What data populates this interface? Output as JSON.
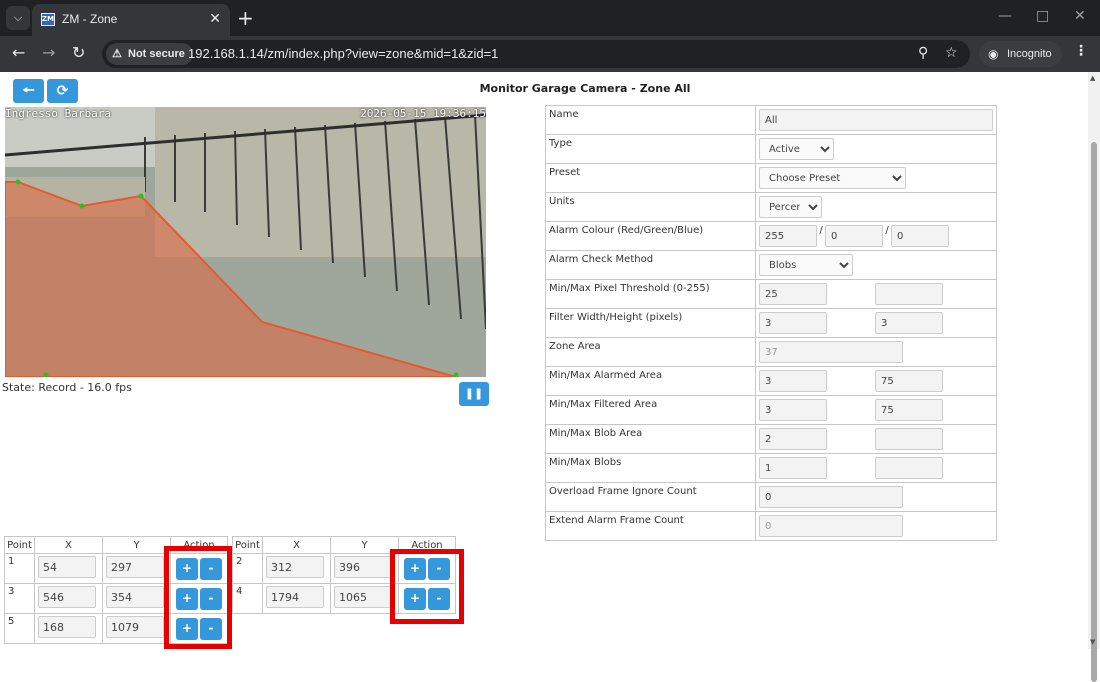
{
  "browser": {
    "tab_title": "ZM - Zone",
    "favicon_text": "ZM",
    "not_secure_label": "Not secure",
    "url": "192.168.1.14/zm/index.php?view=zone&mid=1&zid=1",
    "incognito_label": "Incognito"
  },
  "page": {
    "title": "Monitor Garage Camera - Zone All",
    "camera_name_overlay": "Ingresso Barbara",
    "camera_timestamp_overlay": "2026-05-15 19:36:15",
    "state_text": "State: Record - 16.0 fps"
  },
  "points_table": {
    "headers": {
      "point": "Point",
      "x": "X",
      "y": "Y",
      "action": "Action"
    },
    "plus": "+",
    "minus": "-",
    "left": [
      {
        "point": "1",
        "x": "54",
        "y": "297"
      },
      {
        "point": "3",
        "x": "546",
        "y": "354"
      },
      {
        "point": "5",
        "x": "168",
        "y": "1079"
      }
    ],
    "right": [
      {
        "point": "2",
        "x": "312",
        "y": "396"
      },
      {
        "point": "4",
        "x": "1794",
        "y": "1065"
      }
    ]
  },
  "zone_form": {
    "name_label": "Name",
    "name_value": "All",
    "type_label": "Type",
    "type_value": "Active",
    "preset_label": "Preset",
    "preset_value": "Choose Preset",
    "units_label": "Units",
    "units_value": "Percent",
    "alarm_colour_label": "Alarm Colour (Red/Green/Blue)",
    "alarm_red": "255",
    "alarm_green": "0",
    "alarm_blue": "0",
    "slash": "/",
    "check_method_label": "Alarm Check Method",
    "check_method_value": "Blobs",
    "pixel_threshold_label": "Min/Max Pixel Threshold (0-255)",
    "pixel_threshold_min": "25",
    "pixel_threshold_max": "",
    "filter_label": "Filter Width/Height (pixels)",
    "filter_width": "3",
    "filter_height": "3",
    "zone_area_label": "Zone Area",
    "zone_area_value": "37",
    "alarmed_area_label": "Min/Max Alarmed Area",
    "alarmed_min": "3",
    "alarmed_max": "75",
    "filtered_area_label": "Min/Max Filtered Area",
    "filtered_min": "3",
    "filtered_max": "75",
    "blob_area_label": "Min/Max Blob Area",
    "blob_area_min": "2",
    "blob_area_max": "",
    "blobs_label": "Min/Max Blobs",
    "blobs_min": "1",
    "blobs_max": "",
    "overload_label": "Overload Frame Ignore Count",
    "overload_value": "0",
    "extend_label": "Extend Alarm Frame Count",
    "extend_value": "0"
  },
  "colors": {
    "button_blue": "#3498db",
    "highlight_red": "#e60000",
    "zone_fill": "#e0653b"
  }
}
